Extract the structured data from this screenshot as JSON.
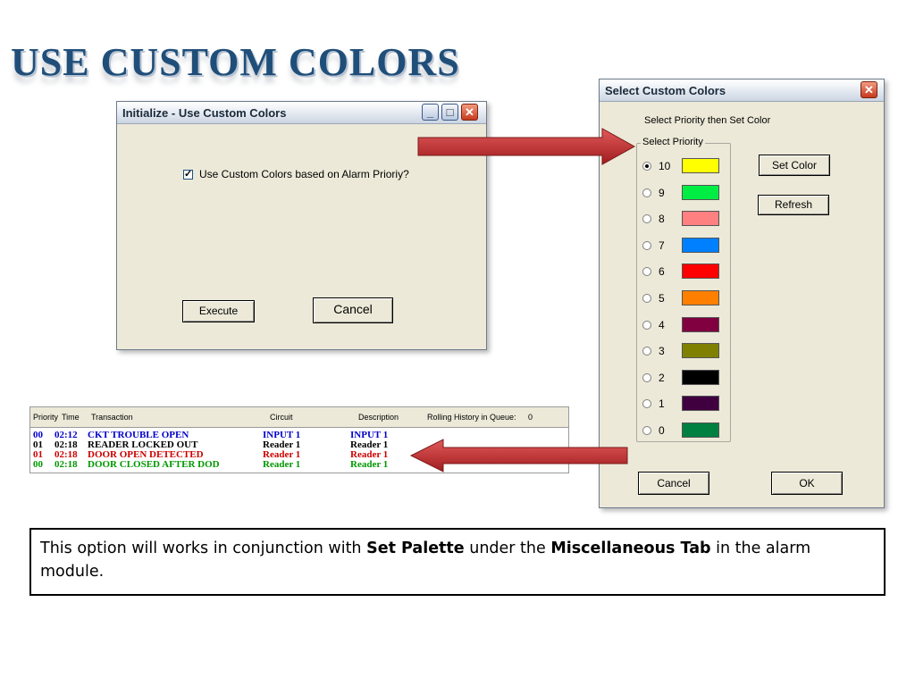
{
  "slide": {
    "title": "USE CUSTOM COLORS"
  },
  "init_window": {
    "title": "Initialize - Use Custom Colors",
    "checkbox_label": "Use Custom Colors based on Alarm Prioriy?",
    "checkbox_checked": true,
    "execute_label": "Execute",
    "cancel_label": "Cancel",
    "minimize_glyph": "_",
    "maximize_glyph": "□",
    "close_glyph": "✕"
  },
  "color_window": {
    "title": "Select Custom Colors",
    "close_glyph": "✕",
    "instruction": "Select Priority then Set Color",
    "group_label": "Select Priority",
    "priorities": [
      {
        "label": "10",
        "color": "#ffff00",
        "selected": true
      },
      {
        "label": "9",
        "color": "#00ee44",
        "selected": false
      },
      {
        "label": "8",
        "color": "#ff8080",
        "selected": false
      },
      {
        "label": "7",
        "color": "#0080ff",
        "selected": false
      },
      {
        "label": "6",
        "color": "#ff0000",
        "selected": false
      },
      {
        "label": "5",
        "color": "#ff8000",
        "selected": false
      },
      {
        "label": "4",
        "color": "#800040",
        "selected": false
      },
      {
        "label": "3",
        "color": "#808000",
        "selected": false
      },
      {
        "label": "2",
        "color": "#000000",
        "selected": false
      },
      {
        "label": "1",
        "color": "#400040",
        "selected": false
      },
      {
        "label": "0",
        "color": "#008040",
        "selected": false
      }
    ],
    "set_color_label": "Set Color",
    "refresh_label": "Refresh",
    "cancel_label": "Cancel",
    "ok_label": "OK"
  },
  "alarm_list": {
    "headers": {
      "priority": "Priority",
      "time": "Time",
      "transaction": "Transaction",
      "circuit": "Circuit",
      "description": "Description",
      "rolling_label": "Rolling History in Queue:",
      "rolling_count": "0"
    },
    "rows": [
      {
        "priority": "00",
        "time": "02:12",
        "transaction": "CKT TROUBLE OPEN",
        "circuit": "INPUT 1",
        "description": "INPUT 1",
        "color": "#0000cc"
      },
      {
        "priority": "01",
        "time": "02:18",
        "transaction": "READER LOCKED OUT",
        "circuit": "Reader 1",
        "description": "Reader 1",
        "color": "#000000"
      },
      {
        "priority": "01",
        "time": "02:18",
        "transaction": "DOOR OPEN DETECTED",
        "circuit": "Reader 1",
        "description": "Reader 1",
        "color": "#cc0000"
      },
      {
        "priority": "00",
        "time": "02:18",
        "transaction": "DOOR CLOSED AFTER DOD",
        "circuit": "Reader 1",
        "description": "Reader 1",
        "color": "#009900"
      }
    ]
  },
  "note": {
    "part1": "This option will works in conjunction with ",
    "bold1": "Set Palette",
    "part2": " under the ",
    "bold2": "Miscellaneous Tab",
    "part3": " in the alarm module."
  },
  "colors": {
    "title": "#1f4e79",
    "arrow": "#c0282a"
  }
}
